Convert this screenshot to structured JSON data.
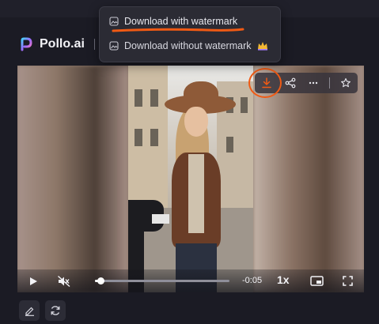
{
  "header": {
    "brand": "Pollo.ai"
  },
  "download_menu": {
    "with_watermark": "Download with watermark",
    "without_watermark": "Download without watermark"
  },
  "player": {
    "time_remaining": "-0:05",
    "speed": "1x",
    "progress": 0.04
  },
  "colors": {
    "accent": "#f05a14",
    "background": "#1b1b24",
    "menu": "#2b2b34"
  },
  "icons": [
    "pollo-logo-icon",
    "image-icon",
    "crown-icon",
    "download-icon",
    "share-icon",
    "more-icon",
    "star-icon",
    "play-icon",
    "mute-icon",
    "pip-icon",
    "fullscreen-icon",
    "edit-icon",
    "refresh-icon"
  ]
}
